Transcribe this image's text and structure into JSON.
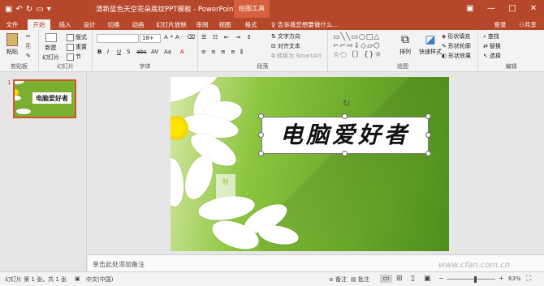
{
  "titlebar": {
    "doc_title": "清新蓝色天空花朵底纹PPT模板 - PowerPoint",
    "context_tab": "绘图工具",
    "login": "登录",
    "share": "共享",
    "minimize": "—",
    "maximize": "□",
    "close": "✕"
  },
  "tabs": [
    "文件",
    "开始",
    "插入",
    "设计",
    "切换",
    "动画",
    "幻灯片放映",
    "审阅",
    "视图",
    "格式"
  ],
  "tell_me": "告诉我您想要做什么...",
  "ribbon": {
    "clipboard": {
      "label": "剪贴板",
      "paste": "粘贴"
    },
    "slides": {
      "label": "幻灯片",
      "new": "新建",
      "new2": "幻灯片",
      "layout": "版式",
      "reset": "重置",
      "section": "节"
    },
    "font": {
      "label": "字体",
      "size": "18+"
    },
    "paragraph": {
      "label": "段落",
      "text_dir": "文字方向",
      "align": "对齐文本",
      "smartart": "转换为 SmartArt"
    },
    "drawing": {
      "label": "绘图",
      "arrange": "排列",
      "quick": "快速样式",
      "fill": "形状填充",
      "outline": "形状轮廓",
      "effect": "形状效果"
    },
    "editing": {
      "label": "编辑",
      "find": "查找",
      "replace": "替换",
      "select": "选择"
    }
  },
  "slide_thumb": {
    "number": "1",
    "text": "电脑爱好者"
  },
  "slide": {
    "title": "电脑爱好者",
    "small_text": "秋"
  },
  "notes": "单击此处添加备注",
  "status": {
    "slide_info": "幻灯片 第 1 张，共 1 张",
    "lang": "中文(中国)",
    "notes_btn": "备注",
    "comments_btn": "批注",
    "zoom": "63%"
  },
  "watermark": "www.cfan.com.cn",
  "colors": {
    "accent": "#b7472a",
    "slide_green": "#7ab030"
  }
}
